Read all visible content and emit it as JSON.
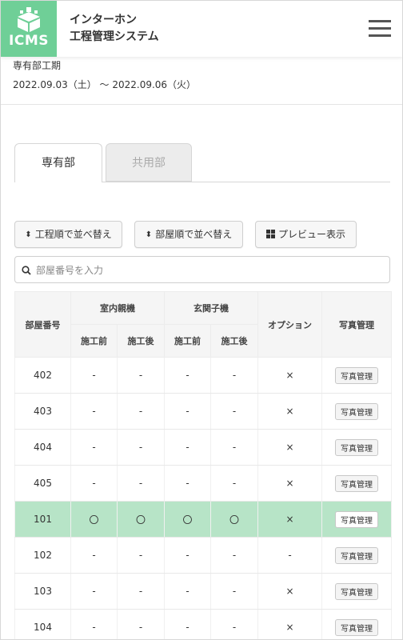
{
  "header": {
    "logo_text": "ICMS",
    "app_title": "インターホン\n工程管理システム"
  },
  "period": {
    "label": "専有部工期",
    "range": "2022.09.03（土） ～ 2022.09.06（火）"
  },
  "tabs": [
    {
      "label": "専有部",
      "active": true
    },
    {
      "label": "共用部",
      "active": false
    }
  ],
  "buttons": {
    "sort_process": "工程順で並べ替え",
    "sort_room": "部屋順で並べ替え",
    "preview": "プレビュー表示"
  },
  "search": {
    "placeholder": "部屋番号を入力",
    "value": ""
  },
  "table": {
    "headers": {
      "room": "部屋番号",
      "indoor": "室内親機",
      "entrance": "玄関子機",
      "option": "オプション",
      "photo": "写真管理",
      "before": "施工前",
      "after": "施工後"
    },
    "rows": [
      {
        "room": "402",
        "indoor_before": "-",
        "indoor_after": "-",
        "ent_before": "-",
        "ent_after": "-",
        "option": "×",
        "photo": "写真管理",
        "highlight": false
      },
      {
        "room": "403",
        "indoor_before": "-",
        "indoor_after": "-",
        "ent_before": "-",
        "ent_after": "-",
        "option": "×",
        "photo": "写真管理",
        "highlight": false
      },
      {
        "room": "404",
        "indoor_before": "-",
        "indoor_after": "-",
        "ent_before": "-",
        "ent_after": "-",
        "option": "×",
        "photo": "写真管理",
        "highlight": false
      },
      {
        "room": "405",
        "indoor_before": "-",
        "indoor_after": "-",
        "ent_before": "-",
        "ent_after": "-",
        "option": "×",
        "photo": "写真管理",
        "highlight": false
      },
      {
        "room": "101",
        "indoor_before": "〇",
        "indoor_after": "〇",
        "ent_before": "〇",
        "ent_after": "〇",
        "option": "×",
        "photo": "写真管理",
        "highlight": true
      },
      {
        "room": "102",
        "indoor_before": "-",
        "indoor_after": "-",
        "ent_before": "-",
        "ent_after": "-",
        "option": "-",
        "photo": "写真管理",
        "highlight": false
      },
      {
        "room": "103",
        "indoor_before": "-",
        "indoor_after": "-",
        "ent_before": "-",
        "ent_after": "-",
        "option": "×",
        "photo": "写真管理",
        "highlight": false
      },
      {
        "room": "104",
        "indoor_before": "-",
        "indoor_after": "-",
        "ent_before": "-",
        "ent_after": "-",
        "option": "×",
        "photo": "写真管理",
        "highlight": false
      }
    ]
  },
  "colors": {
    "brand": "#6fcf97",
    "highlight_row": "#b7e4c7"
  },
  "icons": {
    "logo": "building-blocks-icon",
    "menu": "hamburger-menu-icon",
    "sort": "sort-updown-icon",
    "preview": "grid-icon",
    "search": "search-icon"
  }
}
